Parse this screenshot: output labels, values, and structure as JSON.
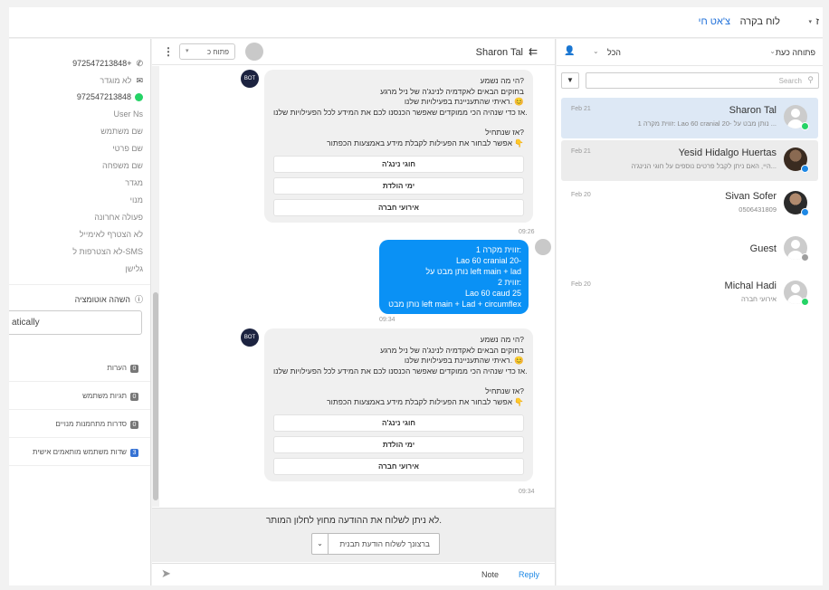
{
  "topbar": {
    "menu_char": "ז",
    "dashboard_label": "לוח בקרה",
    "livechat_label": "צ'אט חי",
    "chevron": "▾"
  },
  "profile": {
    "phone1": "972547213848+",
    "email": "לא מוגדר",
    "phone2": "972547213848",
    "fields": [
      "User Ns",
      "שם משתמש",
      "שם פרטי",
      "שם משפחה",
      "מגדר",
      "מנוי",
      "פעולה אחרונה",
      "לא הצטרף לאימייל",
      "לא הצטרפות ל-SMS",
      "גלישן"
    ],
    "automation_label": "השהה אוטומציה",
    "automation_value": "atically",
    "sections": [
      {
        "label": "הערות",
        "count": "0",
        "color": "#777777"
      },
      {
        "label": "תגיות משתמש",
        "count": "0",
        "color": "#777777"
      },
      {
        "label": "סדרות מתחמנות מנויים",
        "count": "0",
        "color": "#777777"
      },
      {
        "label": "שדות משתמש מותאמים אישית",
        "count": "3",
        "color": "#3572d4"
      }
    ]
  },
  "chat": {
    "contact_name": "Sharon Tal",
    "status_select": "פתוח כ",
    "bot_logo": "BOT",
    "bot_message_1": {
      "lines": [
        "הי מה נשמע?",
        "בחוקים הבאים לאקדמיה לנינג'ה של ניל מרגע",
        "ראיתי שהתעניינת בפעילויות שלנו. 😊",
        "אז כדי שנהיה הכי ממוקדים שאפשר הכנסנו לכם את המידע לכל הפעילויות שלנו.",
        "",
        "אז שנתחיל?",
        "אפשר לבחור את הפעילות לקבלת מידע באמצעות הכפתור 👇"
      ],
      "buttons": [
        "חוגי נינג'ה",
        "ימי הולדת",
        "אירועי חברה"
      ],
      "time": "09:26"
    },
    "sent_message": {
      "lines": [
        "זווית מקרה 1:",
        "Lao 60 cranial 20-",
        "נותן מבט על left main + lad",
        "זווית 2:",
        "Lao 60 caud 25",
        "נותן מבט left main + Lad + circumflex"
      ],
      "time": "09:34"
    },
    "bot_message_2": {
      "lines": [
        "הי מה נשמע?",
        "בחוקים הבאים לאקדמיה לנינג'ה של ניל מרגע",
        "ראיתי שהתעניינת בפעילויות שלנו. 😊",
        "אז כדי שנהיה הכי ממוקדים שאפשר הכנסנו לכם את המידע לכל הפעילויות שלנו.",
        "",
        "אז שנתחיל?",
        "אפשר לבחור את הפעילות לקבלת מידע באמצעות הכפתור 👇"
      ],
      "buttons": [
        "חוגי נינג'ה",
        "ימי הולדת",
        "אירועי חברה"
      ],
      "time": "09:34"
    },
    "window_notice": "לא ניתן לשלוח את ההודעה מחוץ לחלון המותר.",
    "template_button": "ברצונך לשלוח הודעת תבנית",
    "tab_note": "Note",
    "tab_reply": "Reply"
  },
  "list": {
    "filter_open": "פתוחה כעת",
    "filter_all": "הכל",
    "search_placeholder": "Search",
    "conversations": [
      {
        "name": "Sharon Tal",
        "preview": "זווית מקרה 1: Lao 60 cranial 20- נותן מבט על ...",
        "date": "Feb 21",
        "channel": "whatsapp",
        "state": "selected"
      },
      {
        "name": "Yesid Hidalgo Huertas",
        "preview": "היי, האם ניתן לקבל פרטים נוספים על חוגי הנינג'ה...",
        "date": "Feb 21",
        "channel": "messenger",
        "state": "highlight"
      },
      {
        "name": "Sivan Sofer",
        "preview": "0506431809",
        "date": "Feb 20",
        "channel": "messenger",
        "state": ""
      },
      {
        "name": "Guest",
        "preview": "",
        "date": "",
        "channel": "web",
        "state": ""
      },
      {
        "name": "Michal Hadi",
        "preview": "אירועי חברה",
        "date": "Feb 20",
        "channel": "whatsapp",
        "state": ""
      }
    ]
  }
}
